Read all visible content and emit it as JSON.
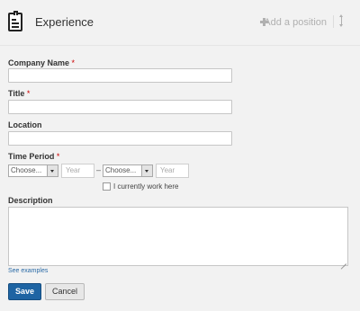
{
  "header": {
    "icon": "resume-icon",
    "title": "Experience",
    "add_label": "Add a position"
  },
  "form": {
    "company_label": "Company Name",
    "title_label": "Title",
    "location_label": "Location",
    "time_period_label": "Time Period",
    "required_mark": "*",
    "start_month": "Choose...",
    "start_year_placeholder": "Year",
    "separator": "–",
    "end_month": "Choose...",
    "end_year_placeholder": "Year",
    "current_work_label": "I currently work here",
    "description_label": "Description",
    "see_examples": "See examples"
  },
  "actions": {
    "save": "Save",
    "cancel": "Cancel"
  },
  "colors": {
    "primary_button": "#1e64a3",
    "required": "#cc0000",
    "link": "#2a6aa6"
  }
}
